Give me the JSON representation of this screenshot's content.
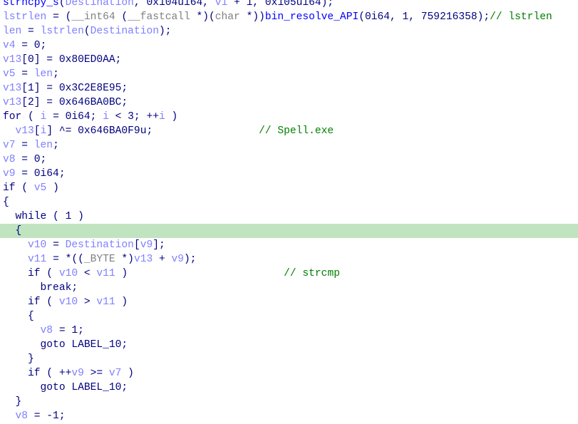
{
  "colors": {
    "variable": "#7f7fff",
    "keyword": "#000080",
    "type": "#808080",
    "function": "#0000ff",
    "comment": "#008000",
    "highlight": "#c0e4c0"
  },
  "highlighted_line": 16,
  "lines": [
    {
      "tokens": [
        [
          "strncpy_s",
          "f"
        ],
        [
          "(",
          "p"
        ],
        [
          "Destination",
          "v"
        ],
        [
          ", 0x104ui64, ",
          "p"
        ],
        [
          "v1",
          "v"
        ],
        [
          " + 1, 0x105ui64);",
          "p"
        ]
      ]
    },
    {
      "tokens": [
        [
          "lstrlen",
          "v"
        ],
        [
          " = (",
          "p"
        ],
        [
          "__int64",
          "t"
        ],
        [
          " (",
          "p"
        ],
        [
          "__fastcall",
          "t"
        ],
        [
          " *)(",
          "p"
        ],
        [
          "char",
          "t"
        ],
        [
          " *))",
          "p"
        ],
        [
          "bin_resolve_API",
          "f"
        ],
        [
          "(0i64, 1, 759216358);",
          "p"
        ],
        [
          "// lstrlen",
          "c"
        ]
      ]
    },
    {
      "tokens": [
        [
          "len",
          "v"
        ],
        [
          " = ",
          "p"
        ],
        [
          "lstrlen",
          "v"
        ],
        [
          "(",
          "p"
        ],
        [
          "Destination",
          "v"
        ],
        [
          ");",
          "p"
        ]
      ]
    },
    {
      "tokens": [
        [
          "v4",
          "v"
        ],
        [
          " = 0;",
          "p"
        ]
      ]
    },
    {
      "tokens": [
        [
          "v13",
          "v"
        ],
        [
          "[0] = 0x80ED0AA;",
          "p"
        ]
      ]
    },
    {
      "tokens": [
        [
          "v5",
          "v"
        ],
        [
          " = ",
          "p"
        ],
        [
          "len",
          "v"
        ],
        [
          ";",
          "p"
        ]
      ]
    },
    {
      "tokens": [
        [
          "v13",
          "v"
        ],
        [
          "[1] = 0x3C2E8E95;",
          "p"
        ]
      ]
    },
    {
      "tokens": [
        [
          "v13",
          "v"
        ],
        [
          "[2] = 0x646BA0BC;",
          "p"
        ]
      ]
    },
    {
      "tokens": [
        [
          "for ( ",
          "p"
        ],
        [
          "i",
          "v"
        ],
        [
          " = 0i64; ",
          "p"
        ],
        [
          "i",
          "v"
        ],
        [
          " < 3; ++",
          "p"
        ],
        [
          "i",
          "v"
        ],
        [
          " )",
          "p"
        ]
      ]
    },
    {
      "tokens": [
        [
          "  ",
          "p"
        ],
        [
          "v13",
          "v"
        ],
        [
          "[",
          "p"
        ],
        [
          "i",
          "v"
        ],
        [
          "] ^= 0x646BA0F9u;                 ",
          "p"
        ],
        [
          "// Spell.exe",
          "c"
        ]
      ]
    },
    {
      "tokens": [
        [
          "v7",
          "v"
        ],
        [
          " = ",
          "p"
        ],
        [
          "len",
          "v"
        ],
        [
          ";",
          "p"
        ]
      ]
    },
    {
      "tokens": [
        [
          "v8",
          "v"
        ],
        [
          " = 0;",
          "p"
        ]
      ]
    },
    {
      "tokens": [
        [
          "v9",
          "v"
        ],
        [
          " = 0i64;",
          "p"
        ]
      ]
    },
    {
      "tokens": [
        [
          "if ( ",
          "p"
        ],
        [
          "v5",
          "v"
        ],
        [
          " )",
          "p"
        ]
      ]
    },
    {
      "tokens": [
        [
          "{",
          "p"
        ]
      ]
    },
    {
      "tokens": [
        [
          "  while ( 1 )",
          "p"
        ]
      ]
    },
    {
      "tokens": [
        [
          "  {",
          "p"
        ]
      ]
    },
    {
      "tokens": [
        [
          "    ",
          "p"
        ],
        [
          "v10",
          "v"
        ],
        [
          " = ",
          "p"
        ],
        [
          "Destination",
          "v"
        ],
        [
          "[",
          "p"
        ],
        [
          "v9",
          "v"
        ],
        [
          "];",
          "p"
        ]
      ]
    },
    {
      "tokens": [
        [
          "    ",
          "p"
        ],
        [
          "v11",
          "v"
        ],
        [
          " = *((",
          "p"
        ],
        [
          "_BYTE",
          "t"
        ],
        [
          " *)",
          "p"
        ],
        [
          "v13",
          "v"
        ],
        [
          " + ",
          "p"
        ],
        [
          "v9",
          "v"
        ],
        [
          ");",
          "p"
        ]
      ]
    },
    {
      "tokens": [
        [
          "    if ( ",
          "p"
        ],
        [
          "v10",
          "v"
        ],
        [
          " < ",
          "p"
        ],
        [
          "v11",
          "v"
        ],
        [
          " )                         ",
          "p"
        ],
        [
          "// strcmp",
          "c"
        ]
      ]
    },
    {
      "tokens": [
        [
          "      break;",
          "p"
        ]
      ]
    },
    {
      "tokens": [
        [
          "    if ( ",
          "p"
        ],
        [
          "v10",
          "v"
        ],
        [
          " > ",
          "p"
        ],
        [
          "v11",
          "v"
        ],
        [
          " )",
          "p"
        ]
      ]
    },
    {
      "tokens": [
        [
          "    {",
          "p"
        ]
      ]
    },
    {
      "tokens": [
        [
          "      ",
          "p"
        ],
        [
          "v8",
          "v"
        ],
        [
          " = 1;",
          "p"
        ]
      ]
    },
    {
      "tokens": [
        [
          "      goto LABEL_10;",
          "p"
        ]
      ]
    },
    {
      "tokens": [
        [
          "    }",
          "p"
        ]
      ]
    },
    {
      "tokens": [
        [
          "    if ( ++",
          "p"
        ],
        [
          "v9",
          "v"
        ],
        [
          " >= ",
          "p"
        ],
        [
          "v7",
          "v"
        ],
        [
          " )",
          "p"
        ]
      ]
    },
    {
      "tokens": [
        [
          "      goto LABEL_10;",
          "p"
        ]
      ]
    },
    {
      "tokens": [
        [
          "  }",
          "p"
        ]
      ]
    },
    {
      "tokens": [
        [
          "  ",
          "p"
        ],
        [
          "v8",
          "v"
        ],
        [
          " = -1;",
          "p"
        ]
      ]
    }
  ]
}
